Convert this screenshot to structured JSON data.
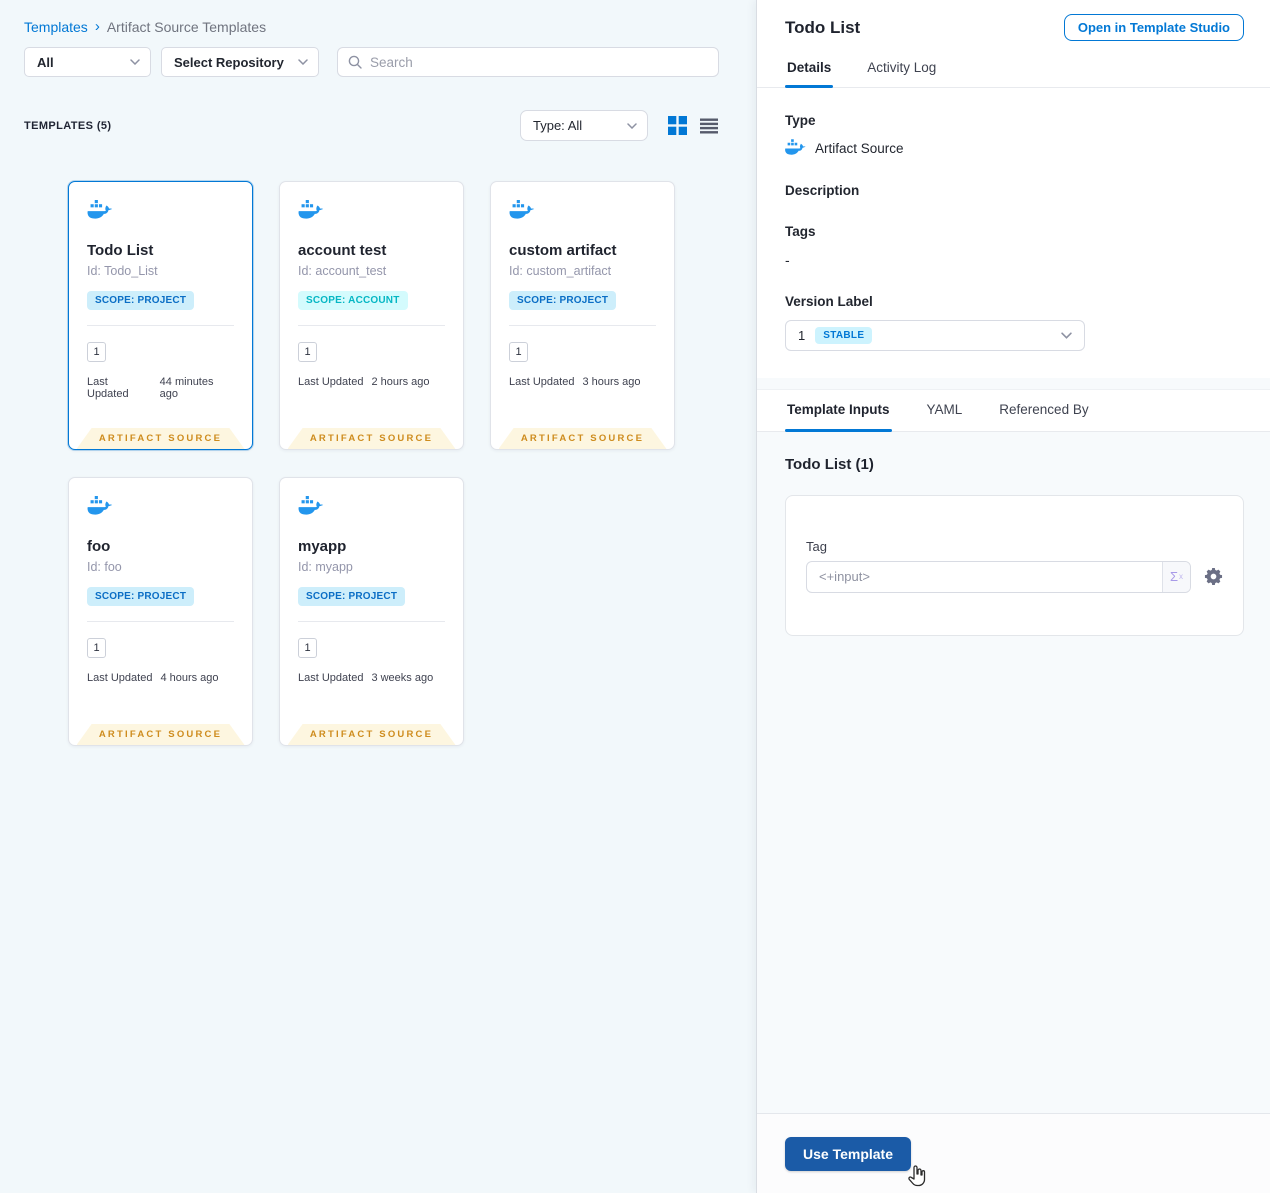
{
  "colors": {
    "accent": "#0278d5",
    "docker_blue": "#2396ed",
    "scope_project_bg": "#cdeefb",
    "scope_project_text": "#0b6ec5",
    "scope_account_bg": "#d4fbfd",
    "scope_account_text": "#06b7c4",
    "ribbon_bg": "#fdf6e0",
    "ribbon_text": "#ce8c1e",
    "stable_badge_bg": "#cdf3fe",
    "stable_badge_text": "#0278d5",
    "use_template_bg": "#1b5ba7",
    "left_bg": "#f2f8fb",
    "right_bg": "#f7fafc"
  },
  "icons": {
    "search": "magnifier",
    "chevron": "chevron-down",
    "grid_view": "grid-2x2-squares",
    "list_view": "horizontal-rows",
    "docker": "docker-whale",
    "gear": "gear",
    "sigma": "Σ",
    "sigma_sup": "x",
    "cursor": "hand-pointer",
    "breadcrumb_separator": "›"
  },
  "left": {
    "breadcrumb": {
      "home": "Templates",
      "separator": "›",
      "current": "Artifact Source Templates"
    },
    "filters": {
      "scope": "All",
      "repository": "Select Repository",
      "search_placeholder": "Search"
    },
    "list_header": {
      "title": "TEMPLATES (5)",
      "type_filter": "Type: All"
    },
    "cards": [
      {
        "name": "Todo List",
        "id": "Id: Todo_List",
        "scope": "SCOPE: PROJECT",
        "scope_kind": "project",
        "version_count": "1",
        "updated_label": "Last Updated",
        "updated": "44 minutes ago",
        "ribbon": "ARTIFACT SOURCE",
        "selected": true
      },
      {
        "name": "account test",
        "id": "Id: account_test",
        "scope": "SCOPE: ACCOUNT",
        "scope_kind": "account",
        "version_count": "1",
        "updated_label": "Last Updated",
        "updated": "2 hours ago",
        "ribbon": "ARTIFACT SOURCE",
        "selected": false
      },
      {
        "name": "custom artifact",
        "id": "Id: custom_artifact",
        "scope": "SCOPE: PROJECT",
        "scope_kind": "project",
        "version_count": "1",
        "updated_label": "Last Updated",
        "updated": "3 hours ago",
        "ribbon": "ARTIFACT SOURCE",
        "selected": false
      },
      {
        "name": "foo",
        "id": "Id: foo",
        "scope": "SCOPE: PROJECT",
        "scope_kind": "project",
        "version_count": "1",
        "updated_label": "Last Updated",
        "updated": "4 hours ago",
        "ribbon": "ARTIFACT SOURCE",
        "selected": false
      },
      {
        "name": "myapp",
        "id": "Id: myapp",
        "scope": "SCOPE: PROJECT",
        "scope_kind": "project",
        "version_count": "1",
        "updated_label": "Last Updated",
        "updated": "3 weeks ago",
        "ribbon": "ARTIFACT SOURCE",
        "selected": false
      }
    ]
  },
  "panel": {
    "title": "Todo List",
    "open_studio_label": "Open in Template Studio",
    "tabs": [
      "Details",
      "Activity Log"
    ],
    "fields": {
      "type_label": "Type",
      "type_value": "Artifact Source",
      "description_label": "Description",
      "tags_label": "Tags",
      "tags_value": "-",
      "version_label": "Version Label",
      "version_value": "1",
      "version_badge": "STABLE"
    },
    "inner_tabs": [
      "Template Inputs",
      "YAML",
      "Referenced By"
    ],
    "inputs_heading": "Todo List (1)",
    "tag_input": {
      "label": "Tag",
      "value": "<+input>",
      "sigma": "Σ",
      "sigma_sup": "x"
    },
    "footer": {
      "use_template_label": "Use Template"
    }
  }
}
